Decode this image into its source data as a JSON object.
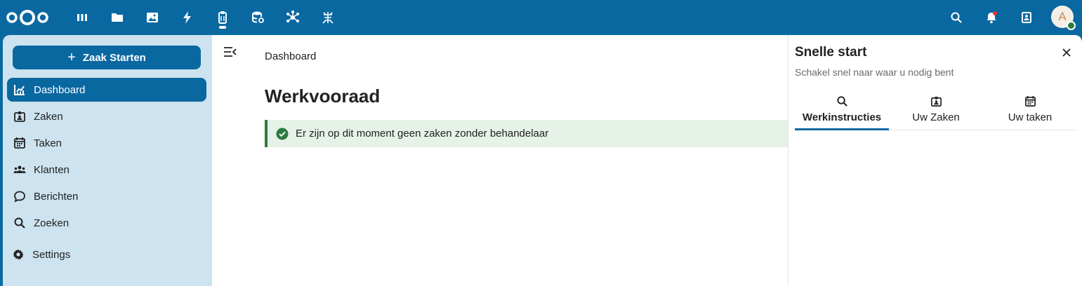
{
  "topbar": {
    "apps": [
      {
        "name": "dashboard-app-icon",
        "icon": "grid-icon"
      },
      {
        "name": "files-app-icon",
        "icon": "folder-icon"
      },
      {
        "name": "photos-app-icon",
        "icon": "image-icon"
      },
      {
        "name": "activity-app-icon",
        "icon": "lightning-icon"
      },
      {
        "name": "cases-app-icon",
        "icon": "clipboard-icon"
      },
      {
        "name": "data-app-icon",
        "icon": "database-icon"
      },
      {
        "name": "federation-app-icon",
        "icon": "network-icon"
      },
      {
        "name": "bug-app-icon",
        "icon": "bug-icon"
      }
    ],
    "avatar_initial": "A",
    "accent_color": "#0a68a1"
  },
  "sidebar": {
    "start_button_label": "Zaak Starten",
    "items": [
      {
        "label": "Dashboard",
        "icon": "chart-icon",
        "active": true
      },
      {
        "label": "Zaken",
        "icon": "badge-icon"
      },
      {
        "label": "Taken",
        "icon": "calendar-icon"
      },
      {
        "label": "Klanten",
        "icon": "people-icon"
      },
      {
        "label": "Berichten",
        "icon": "chat-icon"
      },
      {
        "label": "Zoeken",
        "icon": "search-icon"
      }
    ],
    "settings_label": "Settings"
  },
  "main": {
    "breadcrumb": "Dashboard",
    "title": "Werkvooraad",
    "notice": "Er zijn op dit moment geen zaken zonder behandelaar"
  },
  "panel": {
    "title": "Snelle start",
    "subtitle": "Schakel snel naar waar u nodig bent",
    "tabs": [
      {
        "label": "Werkinstructies",
        "icon": "search-icon",
        "active": true
      },
      {
        "label": "Uw Zaken",
        "icon": "badge-icon"
      },
      {
        "label": "Uw taken",
        "icon": "calendar-icon"
      }
    ]
  }
}
